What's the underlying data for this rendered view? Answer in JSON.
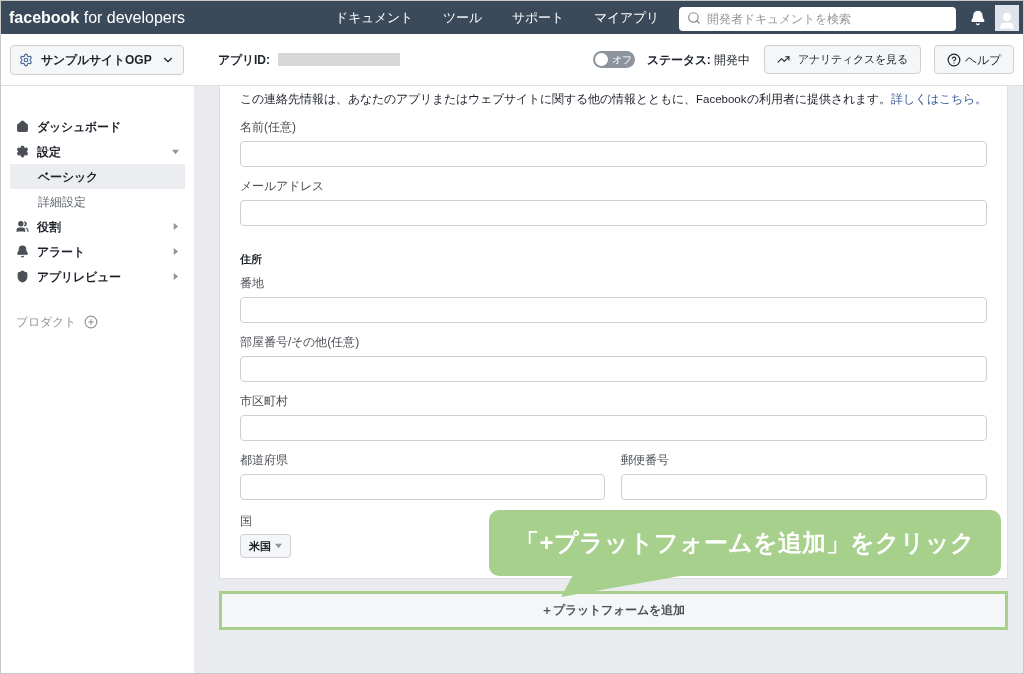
{
  "topbar": {
    "logo_bold": "facebook",
    "logo_light": "for developers",
    "nav": [
      "ドキュメント",
      "ツール",
      "サポート",
      "マイアプリ"
    ],
    "search": {
      "placeholder": "開発者ドキュメントを検索"
    }
  },
  "appbar": {
    "app_selector": "サンプルサイトOGP",
    "app_id_label": "アプリID:",
    "toggle": {
      "label": "オフ",
      "on": false
    },
    "status_label": "ステータス:",
    "status_value": "開発中",
    "analytics_button": "アナリティクスを見る",
    "help_button": "ヘルプ"
  },
  "sidebar": {
    "items": [
      {
        "label": "ダッシュボード",
        "kind": "link"
      },
      {
        "label": "設定",
        "kind": "group",
        "expanded": true,
        "children": [
          {
            "label": "ベーシック",
            "selected": true
          },
          {
            "label": "詳細設定",
            "selected": false
          }
        ]
      },
      {
        "label": "役割",
        "kind": "group",
        "expanded": false
      },
      {
        "label": "アラート",
        "kind": "group",
        "expanded": false
      },
      {
        "label": "アプリレビュー",
        "kind": "group",
        "expanded": false
      }
    ],
    "products_label": "プロダクト"
  },
  "form": {
    "intro": "この連絡先情報は、あなたのアプリまたはウェブサイトに関する他の情報とともに、Facebookの利用者に提供されます。",
    "intro_link": "詳しくはこちら。",
    "rows": [
      {
        "kind": "fields",
        "fields": [
          {
            "label": "名前(任意)"
          }
        ]
      },
      {
        "kind": "fields",
        "fields": [
          {
            "label": "メールアドレス"
          }
        ]
      },
      {
        "kind": "heading",
        "label": "住所"
      },
      {
        "kind": "fields",
        "fields": [
          {
            "label": "番地"
          }
        ]
      },
      {
        "kind": "fields",
        "fields": [
          {
            "label": "部屋番号/その他(任意)"
          }
        ]
      },
      {
        "kind": "fields",
        "fields": [
          {
            "label": "市区町村"
          }
        ]
      },
      {
        "kind": "fields",
        "fields": [
          {
            "label": "都道府県"
          },
          {
            "label": "郵便番号"
          }
        ]
      },
      {
        "kind": "select",
        "label": "国",
        "value": "米国"
      }
    ]
  },
  "add_platform_button": "＋プラットフォームを追加",
  "callout": "「+プラットフォームを追加」をクリック"
}
